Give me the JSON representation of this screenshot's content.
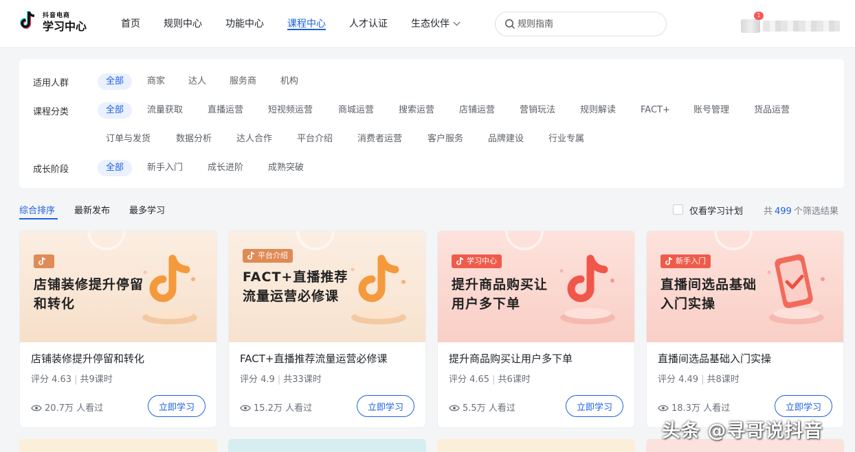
{
  "brand": {
    "top": "抖音电商",
    "name": "学习中心"
  },
  "nav": {
    "items": [
      {
        "label": "首页"
      },
      {
        "label": "规则中心"
      },
      {
        "label": "功能中心"
      },
      {
        "label": "课程中心",
        "active": true
      },
      {
        "label": "人才认证"
      },
      {
        "label": "生态伙伴",
        "dropdown": true
      }
    ]
  },
  "search": {
    "placeholder": "规则指南"
  },
  "user": {
    "badge": "1"
  },
  "filters": {
    "audience": {
      "label": "适用人群",
      "options": [
        "全部",
        "商家",
        "达人",
        "服务商",
        "机构"
      ]
    },
    "category": {
      "label": "课程分类",
      "options_row1": [
        "全部",
        "流量获取",
        "直播运营",
        "短视频运营",
        "商城运营",
        "搜索运营",
        "店铺运营",
        "营销玩法",
        "规则解读",
        "FACT+",
        "账号管理",
        "货品运营"
      ],
      "options_row2": [
        "订单与发货",
        "数据分析",
        "达人合作",
        "平台介绍",
        "消费者运营",
        "客户服务",
        "品牌建设",
        "行业专属"
      ]
    },
    "stage": {
      "label": "成长阶段",
      "options": [
        "全部",
        "新手入门",
        "成长进阶",
        "成熟突破"
      ]
    }
  },
  "sort": {
    "options": [
      "综合排序",
      "最新发布",
      "最多学习"
    ],
    "only_plan": "仅看学习计划",
    "result_prefix": "共",
    "result_count": "499",
    "result_suffix": "个筛选结果"
  },
  "colors": {
    "accent": "#1b5fe3"
  },
  "courses": [
    {
      "cover_tag": "",
      "cover_title": "店铺装修提升停留和转化",
      "title": "店铺装修提升停留和转化",
      "rating": "评分 4.63",
      "lessons": "共9课时",
      "views": "20.7万 人看过",
      "button": "立即学习"
    },
    {
      "cover_tag": "平台介绍",
      "cover_title": "FACT+直播推荐流量运营必修课",
      "title": "FACT+直播推荐流量运营必修课",
      "rating": "评分 4.9",
      "lessons": "共33课时",
      "views": "15.2万 人看过",
      "button": "立即学习"
    },
    {
      "cover_tag": "学习中心",
      "cover_title": "提升商品购买让用户多下单",
      "title": "提升商品购买让用户多下单",
      "rating": "评分 4.65",
      "lessons": "共6课时",
      "views": "5.5万 人看过",
      "button": "立即学习"
    },
    {
      "cover_tag": "新手入门",
      "cover_title": "直播间选品基础入门实操",
      "title": "直播间选品基础入门实操",
      "rating": "评分 4.49",
      "lessons": "共8课时",
      "views": "18.3万 人看过",
      "button": "立即学习"
    }
  ],
  "watermark": "头条 @寻哥说抖音"
}
